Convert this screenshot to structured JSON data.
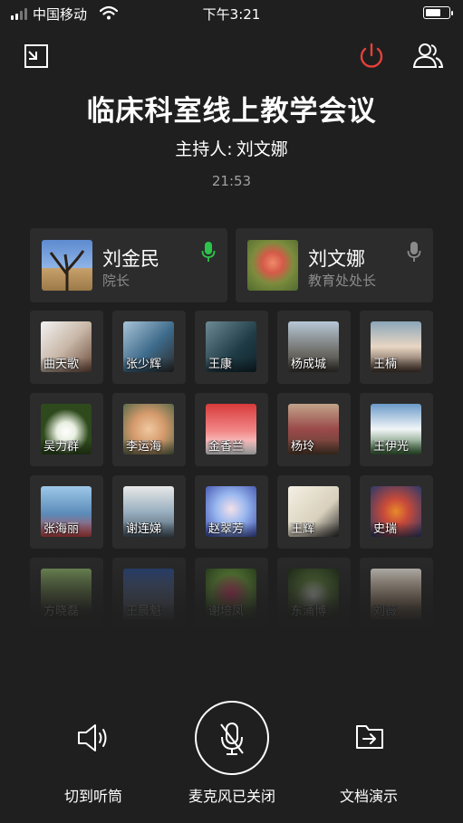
{
  "status_bar": {
    "carrier": "中国移动",
    "time": "下午3:21",
    "battery_level": 0.7
  },
  "meeting": {
    "title": "临床科室线上教学会议",
    "host_label": "主持人:",
    "host_name": "刘文娜",
    "elapsed": "21:53"
  },
  "colors": {
    "power_accent": "#e8403a",
    "mic_active": "#2cc34a",
    "card_bg": "#2c2c2c"
  },
  "speakers": [
    {
      "name": "刘金民",
      "role": "院长",
      "mic": "active"
    },
    {
      "name": "刘文娜",
      "role": "教育处处长",
      "mic": "idle"
    }
  ],
  "participants": [
    "曲天歌",
    "张少辉",
    "王康",
    "杨成城",
    "王楠",
    "吴力群",
    "李运海",
    "金香兰",
    "杨玲",
    "王伊光",
    "张海丽",
    "谢连娣",
    "赵翠芳",
    "王辉",
    "史瑞",
    "方晓磊",
    "王晨魁",
    "谢培凤",
    "东涌博",
    "刘薇"
  ],
  "controls": {
    "earpiece_label": "切到听筒",
    "mic_label": "麦克风已关闭",
    "share_label": "文档演示"
  },
  "icons": {
    "minimize": "minimize-window-icon",
    "power": "power-icon",
    "members": "members-icon",
    "speaker": "speaker-volume-icon",
    "mic_off": "mic-off-icon",
    "share": "folder-share-icon"
  }
}
